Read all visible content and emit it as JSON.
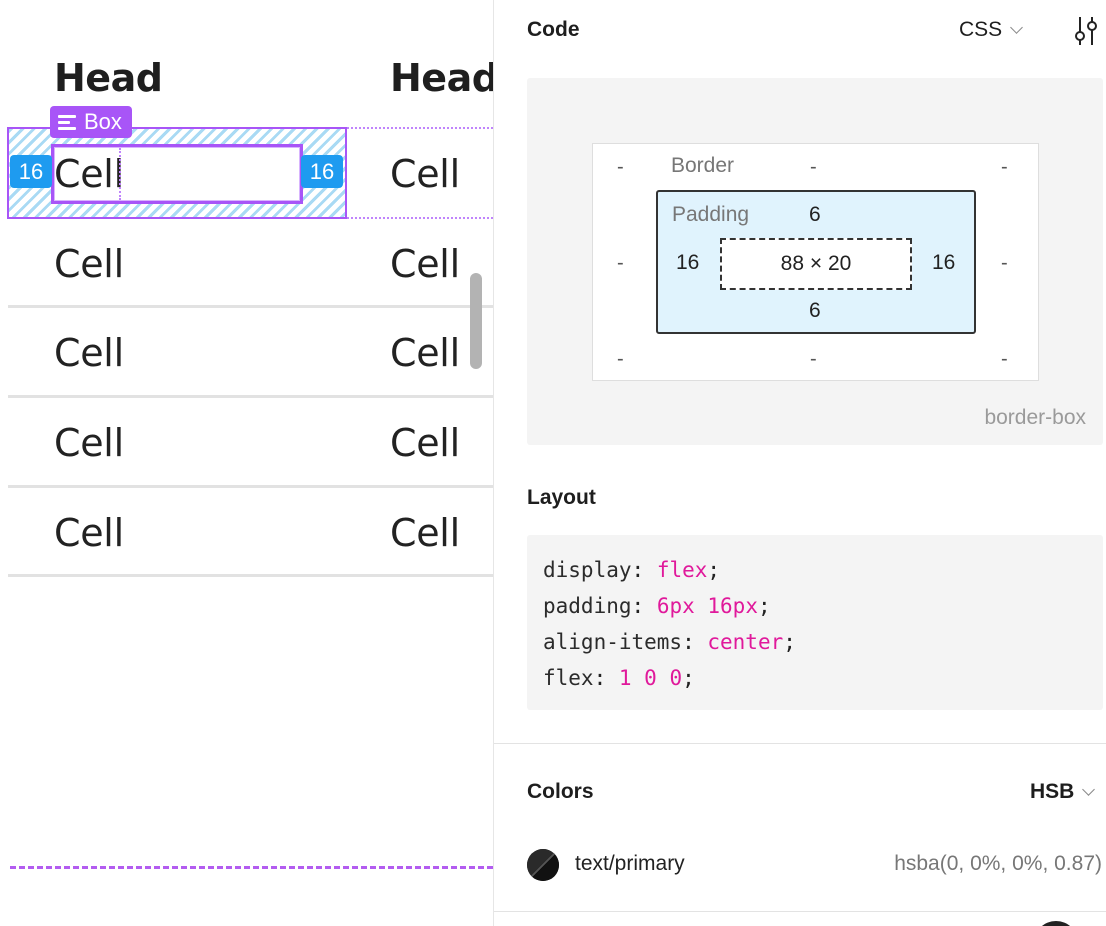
{
  "canvas": {
    "headers": [
      "Head",
      "Head"
    ],
    "selected_row": [
      "Cell",
      "Cell"
    ],
    "rows": [
      [
        "Cell",
        "Cell"
      ],
      [
        "Cell",
        "Cell"
      ],
      [
        "Cell",
        "Cell"
      ],
      [
        "Cell",
        "Cell"
      ]
    ],
    "selection_label": "Box",
    "padding_left_badge": "16",
    "padding_right_badge": "16"
  },
  "panel": {
    "code_title": "Code",
    "language": "CSS",
    "box_model": {
      "border_label": "Border",
      "border_top": "-",
      "border_right": "-",
      "border_bottom": "-",
      "border_left": "-",
      "margin_dash": "-",
      "padding_label": "Padding",
      "padding_top": "6",
      "padding_right": "16",
      "padding_bottom": "6",
      "padding_left": "16",
      "content_size": "88 × 20",
      "box_sizing": "border-box"
    },
    "layout_title": "Layout",
    "layout_css": [
      {
        "prop": "display",
        "value": "flex"
      },
      {
        "prop": "padding",
        "value": "6px 16px"
      },
      {
        "prop": "align-items",
        "value": "center"
      },
      {
        "prop": "flex",
        "value": "1 0 0"
      }
    ],
    "colors_title": "Colors",
    "color_mode": "HSB",
    "colors": [
      {
        "name": "text/primary",
        "value": "hsba(0, 0%, 0%, 0.87)",
        "swatch": "#202020"
      }
    ]
  },
  "accent": {
    "selection": "#a855f7",
    "spacing_badge": "#1e9bf0",
    "css_value": "#e0199b"
  }
}
